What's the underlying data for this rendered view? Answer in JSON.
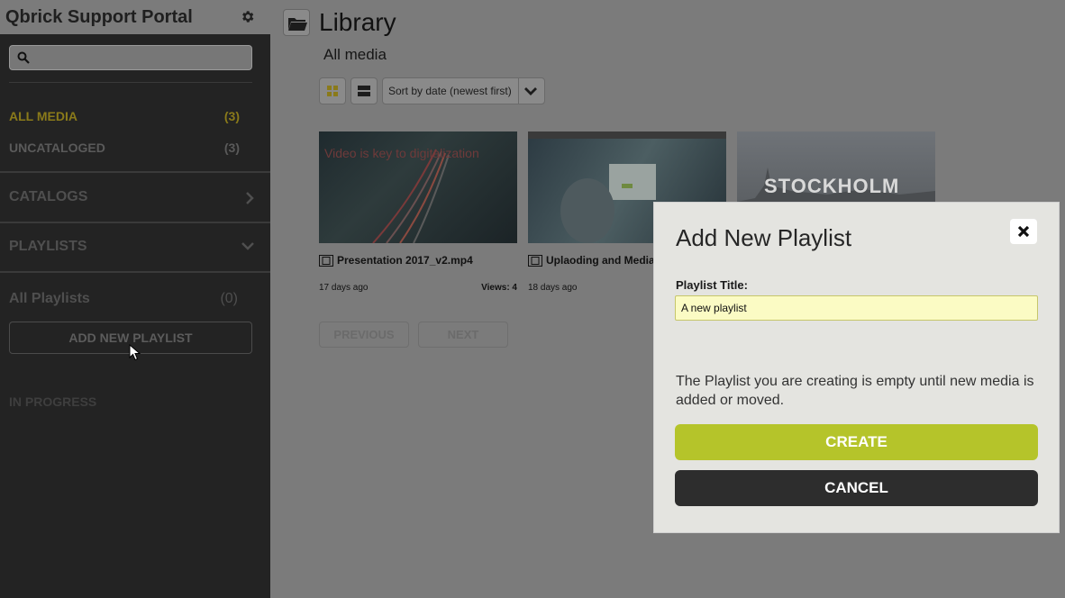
{
  "sidebar": {
    "title": "Qbrick Support Portal",
    "search_placeholder": "",
    "items": [
      {
        "label": "ALL MEDIA",
        "count": "(3)"
      },
      {
        "label": "UNCATALOGED",
        "count": "(3)"
      }
    ],
    "catalogs_label": "CATALOGS",
    "playlists_label": "PLAYLISTS",
    "all_playlists": {
      "label": "All Playlists",
      "count": "(0)"
    },
    "add_playlist_label": "ADD NEW PLAYLIST",
    "in_progress_label": "IN PROGRESS"
  },
  "main": {
    "title": "Library",
    "subtitle": "All media",
    "sort_label": "Sort by date (newest first)",
    "cards": [
      {
        "thumb_text": "Video is key to digitalization",
        "title": "Presentation 2017_v2.mp4",
        "age": "17 days ago",
        "views": "Views: 4"
      },
      {
        "thumb_text": "",
        "title": "Uplaoding and Media",
        "age": "18 days ago",
        "views": ""
      },
      {
        "thumb_text": "STOCKHOLM",
        "title": "",
        "age": "",
        "views": ""
      }
    ],
    "prev_label": "PREVIOUS",
    "next_label": "NEXT"
  },
  "dialog": {
    "title": "Add New Playlist",
    "field_label": "Playlist Title:",
    "field_value": "A new playlist",
    "message": "The Playlist you are creating is empty until new media is added or moved.",
    "create_label": "CREATE",
    "cancel_label": "CANCEL"
  },
  "colors": {
    "accent": "#b5c42a",
    "active_nav": "#8a7a1a",
    "sidebar_bg": "#232323",
    "overlay_bg": "#7b7b7b",
    "input_bg": "#fbfbc4"
  }
}
